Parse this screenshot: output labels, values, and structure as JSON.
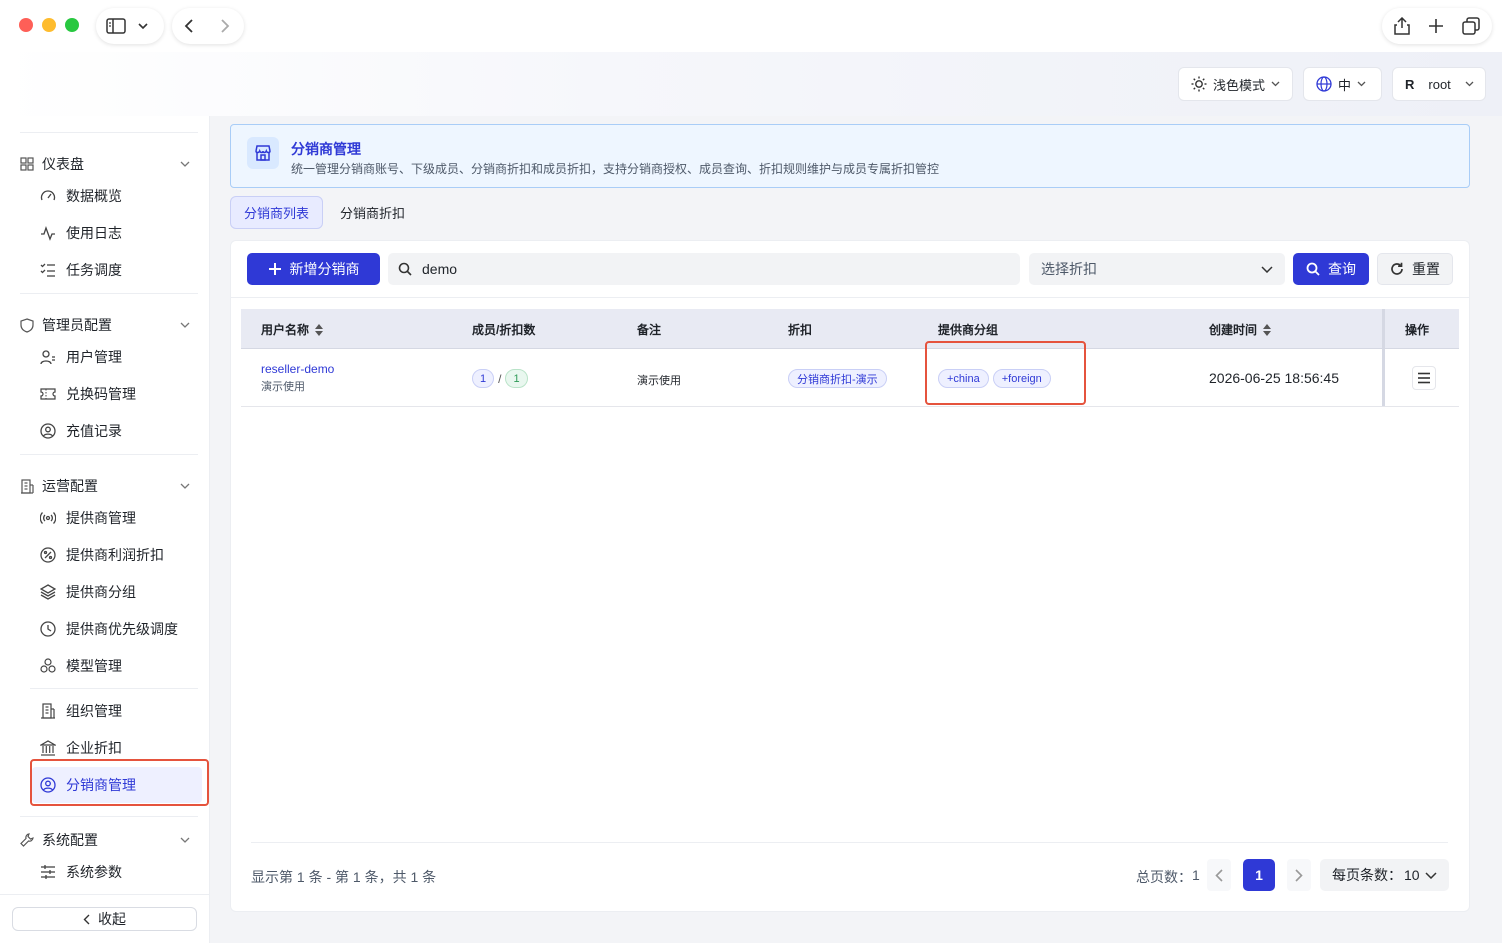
{
  "header": {
    "theme_label": "浅色模式",
    "lang_label": "中",
    "user_initial": "R",
    "user_name": "root"
  },
  "sidebar": {
    "groups": [
      {
        "label": "仪表盘",
        "items": [
          "数据概览",
          "使用日志",
          "任务调度"
        ]
      },
      {
        "label": "管理员配置",
        "items": [
          "用户管理",
          "兑换码管理",
          "充值记录"
        ]
      },
      {
        "label": "运营配置",
        "items": [
          "提供商管理",
          "提供商利润折扣",
          "提供商分组",
          "提供商优先级调度",
          "模型管理",
          "组织管理",
          "企业折扣",
          "分销商管理"
        ]
      },
      {
        "label": "系统配置",
        "items": [
          "系统参数"
        ]
      }
    ],
    "collapse_label": "收起"
  },
  "banner": {
    "title": "分销商管理",
    "description": "统一管理分销商账号、下级成员、分销商折扣和成员折扣，支持分销商授权、成员查询、折扣规则维护与成员专属折扣管控"
  },
  "tabs": [
    "分销商列表",
    "分销商折扣"
  ],
  "toolbar": {
    "add_label": "新增分销商",
    "search_value": "demo",
    "discount_placeholder": "选择折扣",
    "query_label": "查询",
    "reset_label": "重置"
  },
  "table": {
    "headers": [
      "用户名称",
      "成员/折扣数",
      "备注",
      "折扣",
      "提供商分组",
      "创建时间",
      "操作"
    ],
    "rows": [
      {
        "name": "reseller-demo",
        "sub": "演示使用",
        "members": "1",
        "sep": "/",
        "discounts": "1",
        "remark": "演示使用",
        "discount": "分销商折扣-演示",
        "groups": [
          "+china",
          "+foreign"
        ],
        "created": "2026-06-25 18:56:45"
      }
    ]
  },
  "pagination": {
    "summary": "显示第 1 条 - 第 1 条，共 1 条",
    "total_label": "总页数：",
    "total": "1",
    "current": "1",
    "page_size_label": "每页条数：",
    "page_size": "10"
  },
  "colors": {
    "accent": "#2f39d6",
    "highlight": "#e5533d",
    "banner_bg": "#eef6ff",
    "tag_green": "#2e9a57"
  }
}
